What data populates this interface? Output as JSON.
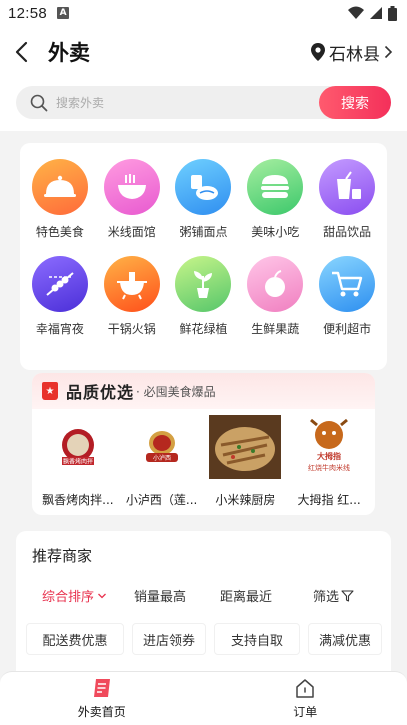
{
  "status": {
    "time": "12:58",
    "notif_letter": "A"
  },
  "nav": {
    "title": "外卖",
    "location": "石林县"
  },
  "search": {
    "placeholder": "搜索外卖",
    "button": "搜索"
  },
  "categories": [
    {
      "label": "特色美食",
      "icon": "cloche-icon",
      "color": "#ff7f3a"
    },
    {
      "label": "米线面馆",
      "icon": "noodle-bowl-icon",
      "color": "#f25fcc"
    },
    {
      "label": "粥铺面点",
      "icon": "porridge-icon",
      "color": "#3ba3f0"
    },
    {
      "label": "美味小吃",
      "icon": "burger-icon",
      "color": "#4cd27a"
    },
    {
      "label": "甜品饮品",
      "icon": "drink-icon",
      "color": "#9b5cf0"
    },
    {
      "label": "幸福宵夜",
      "icon": "skewer-icon",
      "color": "#6a49e8"
    },
    {
      "label": "干锅火锅",
      "icon": "hotpot-icon",
      "color": "#ff6a1a"
    },
    {
      "label": "鲜花绿植",
      "icon": "plant-icon",
      "color": "#55c66a"
    },
    {
      "label": "生鲜果蔬",
      "icon": "fruit-icon",
      "color": "#f08bc8"
    },
    {
      "label": "便利超市",
      "icon": "cart-icon",
      "color": "#2d9bf0"
    }
  ],
  "quality": {
    "title": "品质优选",
    "subtitle": "· 必囤美食爆品",
    "items": [
      {
        "name": "飘香烤肉拌...",
        "logo_text": "飘香烤肉拌"
      },
      {
        "name": "小泸西（莲...",
        "logo_text": "小泸西"
      },
      {
        "name": "小米辣厨房",
        "logo_text": ""
      },
      {
        "name": "大拇指 红...",
        "logo_text_top": "大拇指",
        "logo_text_bottom": "红烧牛肉米线"
      }
    ]
  },
  "merchant": {
    "title": "推荐商家",
    "sorts": [
      "综合排序",
      "销量最高",
      "距离最近",
      "筛选"
    ],
    "filters": [
      "配送费优惠",
      "进店领券",
      "支持自取",
      "满减优惠"
    ]
  },
  "tabs": [
    {
      "label": "外卖首页",
      "icon": "takeout-home-icon"
    },
    {
      "label": "订单",
      "icon": "order-home-icon"
    }
  ],
  "colors": {
    "accent": "#f4305a",
    "active_sort": "#e8314d"
  }
}
